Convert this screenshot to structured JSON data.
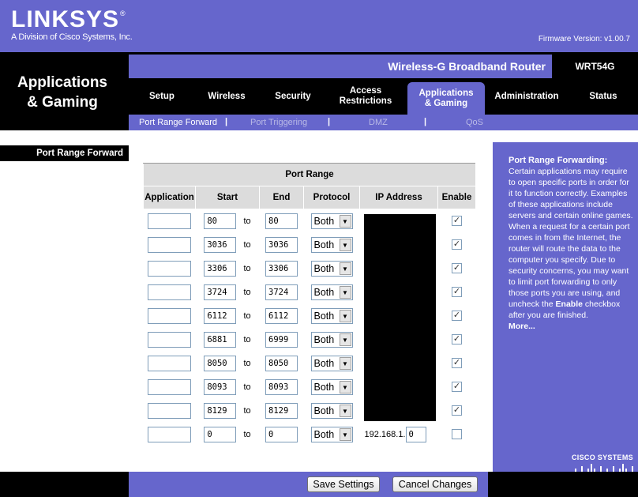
{
  "brand": {
    "logo": "LINKSYS",
    "registered": "®",
    "subtitle": "A Division of Cisco Systems, Inc."
  },
  "firmware": "Firmware Version: v1.00.7",
  "page_heading": [
    "Applications",
    "& Gaming"
  ],
  "product_name": "Wireless-G Broadband Router",
  "model": "WRT54G",
  "tabs": [
    {
      "label": "Setup"
    },
    {
      "label": "Wireless"
    },
    {
      "label": "Security"
    },
    {
      "label": "Access\nRestrictions"
    },
    {
      "label": "Applications\n& Gaming"
    },
    {
      "label": "Administration"
    },
    {
      "label": "Status"
    }
  ],
  "subtabs": [
    "Port Range Forward",
    "Port Triggering",
    "DMZ",
    "QoS"
  ],
  "separator": "|",
  "section_label": "Port Range Forward",
  "table": {
    "title": "Port Range",
    "headers": [
      "Application",
      "Start",
      "End",
      "Protocol",
      "IP Address",
      "Enable"
    ],
    "to_label": "to",
    "rows": [
      {
        "app": "",
        "start": "80",
        "end": "80",
        "protocol": "Both",
        "enabled": true
      },
      {
        "app": "",
        "start": "3036",
        "end": "3036",
        "protocol": "Both",
        "enabled": true
      },
      {
        "app": "",
        "start": "3306",
        "end": "3306",
        "protocol": "Both",
        "enabled": true
      },
      {
        "app": "",
        "start": "3724",
        "end": "3724",
        "protocol": "Both",
        "enabled": true
      },
      {
        "app": "",
        "start": "6112",
        "end": "6112",
        "protocol": "Both",
        "enabled": true
      },
      {
        "app": "",
        "start": "6881",
        "end": "6999",
        "protocol": "Both",
        "enabled": true
      },
      {
        "app": "",
        "start": "8050",
        "end": "8050",
        "protocol": "Both",
        "enabled": true
      },
      {
        "app": "",
        "start": "8093",
        "end": "8093",
        "protocol": "Both",
        "enabled": true
      },
      {
        "app": "",
        "start": "8129",
        "end": "8129",
        "protocol": "Both",
        "enabled": true
      },
      {
        "app": "",
        "start": "0",
        "end": "0",
        "protocol": "Both",
        "enabled": false,
        "ip_prefix": "192.168.1.",
        "ip_last": "0"
      }
    ]
  },
  "help": {
    "title": "Port Range Forwarding:",
    "body_before": "Certain applications may require to open specific ports in order for it to function correctly. Examples of these applications include servers and certain online games. When a request for a certain port comes in from the Internet, the router will route the data to the computer you specify. Due to security concerns, you may want to limit port forwarding to only those ports you are using, and uncheck the ",
    "body_bold": "Enable",
    "body_after": " checkbox after you are finished.",
    "more": "More..."
  },
  "cisco": "CISCO SYSTEMS",
  "buttons": {
    "save": "Save Settings",
    "cancel": "Cancel Changes"
  },
  "colors": {
    "brand_purple": "#6666cc",
    "black": "#000000",
    "header_gray": "#dcdcdc"
  }
}
